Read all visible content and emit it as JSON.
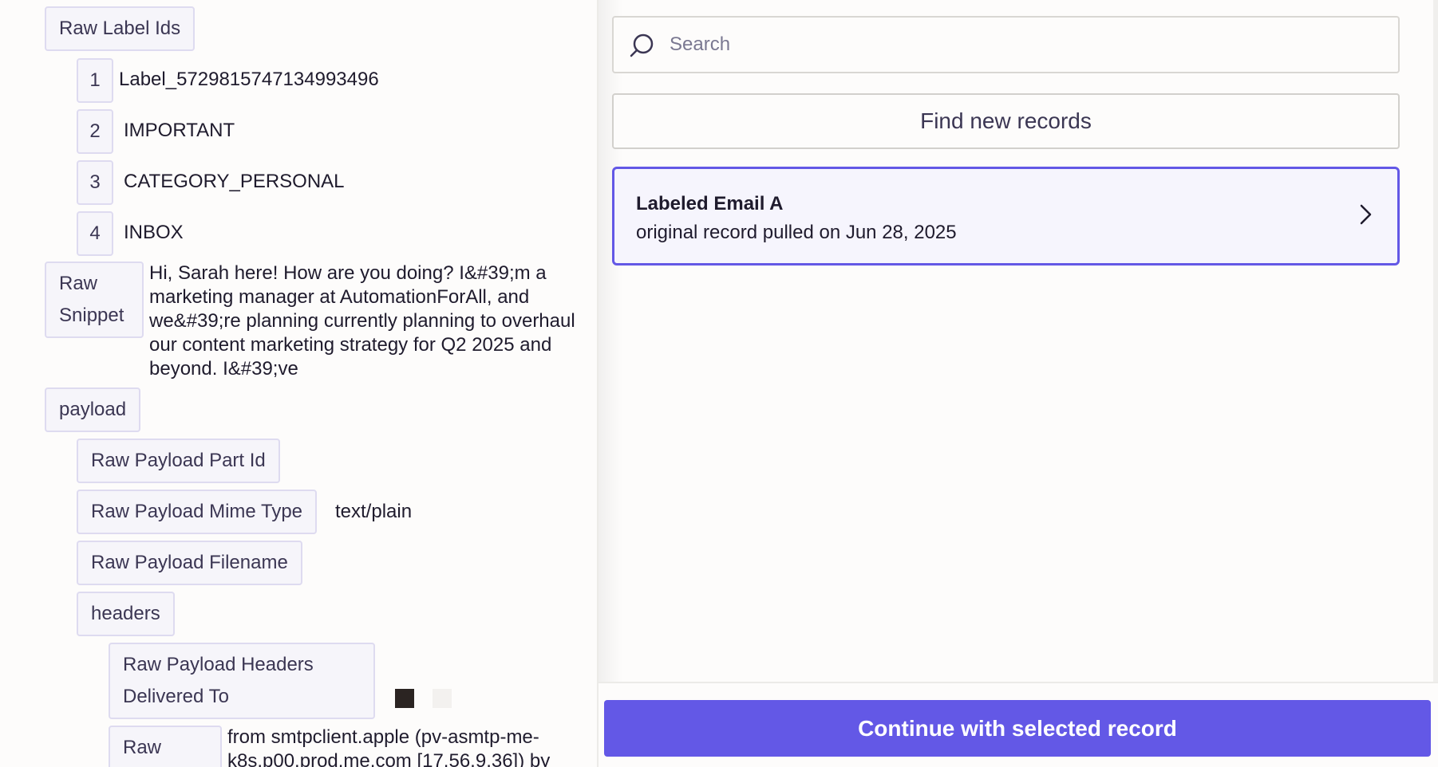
{
  "left_panel": {
    "raw_label_ids": {
      "label": "Raw Label Ids",
      "items": [
        {
          "index": "1",
          "value": "Label_5729815747134993496"
        },
        {
          "index": "2",
          "value": "IMPORTANT"
        },
        {
          "index": "3",
          "value": "CATEGORY_PERSONAL"
        },
        {
          "index": "4",
          "value": "INBOX"
        }
      ]
    },
    "raw_snippet": {
      "label": "Raw Snippet",
      "value": "Hi, Sarah here! How are you doing? I&#39;m a marketing manager at AutomationForAll, and we&#39;re planning currently planning to overhaul our content marketing strategy for Q2 2025 and beyond. I&#39;ve"
    },
    "payload": {
      "label": "payload",
      "part_id_label": "Raw Payload Part Id",
      "mime_type_label": "Raw Payload Mime Type",
      "mime_type_value": "text/plain",
      "filename_label": "Raw Payload Filename",
      "headers_label": "headers",
      "delivered_to_label": "Raw Payload Headers Delivered To",
      "raw_label": "Raw",
      "raw_value": "from smtpclient.apple (pv-asmtp-me-k8s.p00.prod.me.com [17.56.9.36]) by"
    }
  },
  "right_panel": {
    "search": {
      "placeholder": "Search",
      "icon": "search-icon"
    },
    "find_button_label": "Find new records",
    "record": {
      "title": "Labeled Email A",
      "subtitle": "original record pulled on Jun 28, 2025",
      "icon": "chevron-right-icon",
      "selected": true
    },
    "continue_button_label": "Continue with selected record"
  },
  "colors": {
    "accent": "#6358e6",
    "key_background": "#f6f5fa",
    "key_border": "#dedbf0",
    "page_background": "#fdfcfb"
  }
}
